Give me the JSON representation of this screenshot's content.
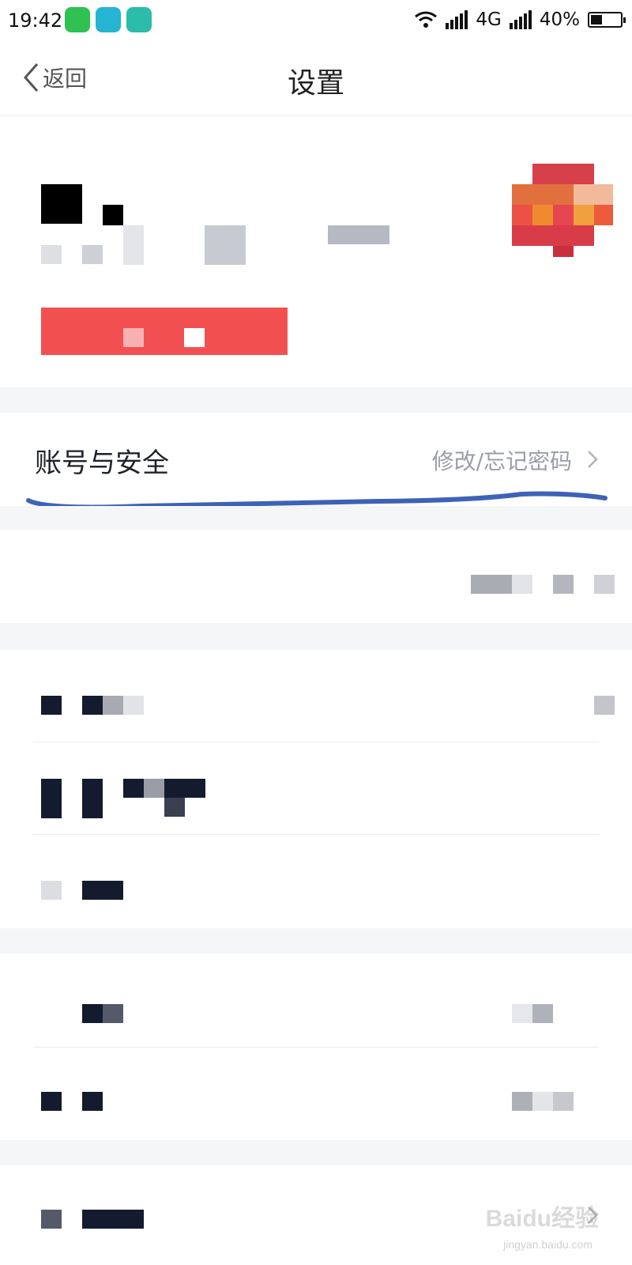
{
  "status_bar": {
    "time": "19:42",
    "network": "4G",
    "battery_text": "40%",
    "battery_level": 0.4
  },
  "nav": {
    "back_label": "返回",
    "title": "设置"
  },
  "account_security": {
    "title": "账号与安全",
    "hint": "修改/忘记密码",
    "annotation_color": "#3d63b8"
  },
  "watermark": {
    "brand": "Baidu经验",
    "url": "jingyan.baidu.com"
  }
}
